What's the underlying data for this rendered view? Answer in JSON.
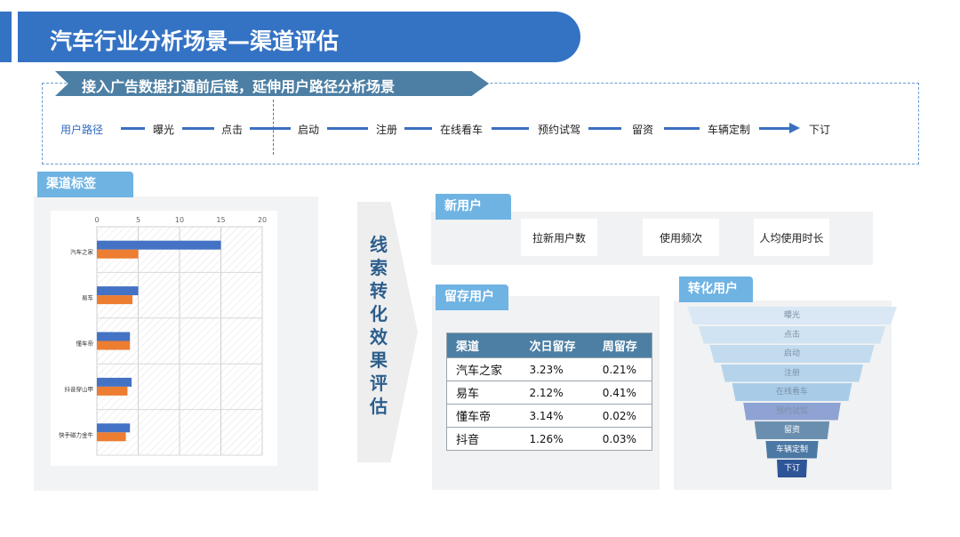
{
  "title": "汽车行业分析场景—渠道评估",
  "path_section": {
    "banner": "接入广告数据打通前后链，延伸用户路径分析场景",
    "steps": [
      "用户路径",
      "曝光",
      "点击",
      "启动",
      "注册",
      "在线看车",
      "预约试驾",
      "留资",
      "车辆定制",
      "下订"
    ]
  },
  "channel_panel": {
    "tab": "渠道标签",
    "chart_data": {
      "type": "bar",
      "orientation": "horizontal",
      "categories": [
        "汽车之家",
        "易车",
        "懂车帝",
        "抖音穿山甲",
        "快手磁力金牛"
      ],
      "series": [
        {
          "color": "#4472c4",
          "values": [
            15,
            5,
            4,
            4.2,
            4
          ]
        },
        {
          "color": "#ed7d31",
          "values": [
            5,
            4.3,
            4,
            3.7,
            3.5
          ]
        }
      ],
      "xticks": [
        0,
        5,
        10,
        15,
        20
      ],
      "xlim": [
        0,
        20
      ],
      "grid": true
    }
  },
  "leads_label": "线索转化效果评估",
  "new_user_panel": {
    "tab": "新用户",
    "metrics": [
      "拉新用户数",
      "使用频次",
      "人均使用时长"
    ]
  },
  "retention_panel": {
    "tab": "留存用户",
    "columns": [
      "渠道",
      "次日留存",
      "周留存"
    ],
    "rows": [
      [
        "汽车之家",
        "3.23%",
        "0.21%"
      ],
      [
        "易车",
        "2.12%",
        "0.41%"
      ],
      [
        "懂车帝",
        "3.14%",
        "0.02%"
      ],
      [
        "抖音",
        "1.26%",
        "0.03%"
      ]
    ]
  },
  "conversion_panel": {
    "tab": "转化用户",
    "funnel": [
      "曝光",
      "点击",
      "启动",
      "注册",
      "在线看车",
      "预约试驾",
      "留资",
      "车辆定制",
      "下订"
    ],
    "colors": [
      "#d9e8f4",
      "#d0e3f2",
      "#c2dbee",
      "#b5d4ec",
      "#a8cce8",
      "#8ea3d3",
      "#6a8fae",
      "#4b78a4",
      "#2e5597"
    ]
  }
}
